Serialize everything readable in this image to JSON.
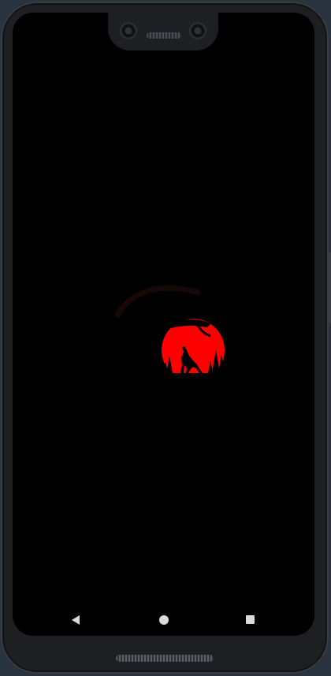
{
  "device": {
    "type": "phone",
    "theme_color": "#000000"
  },
  "app": {
    "splash_logo": "wolf-moon-logo",
    "logo_color": "#ff0000"
  },
  "navigation": {
    "back_icon": "back-triangle-icon",
    "home_icon": "home-circle-icon",
    "recents_icon": "recents-square-icon",
    "icon_color": "#d9d9d9"
  }
}
